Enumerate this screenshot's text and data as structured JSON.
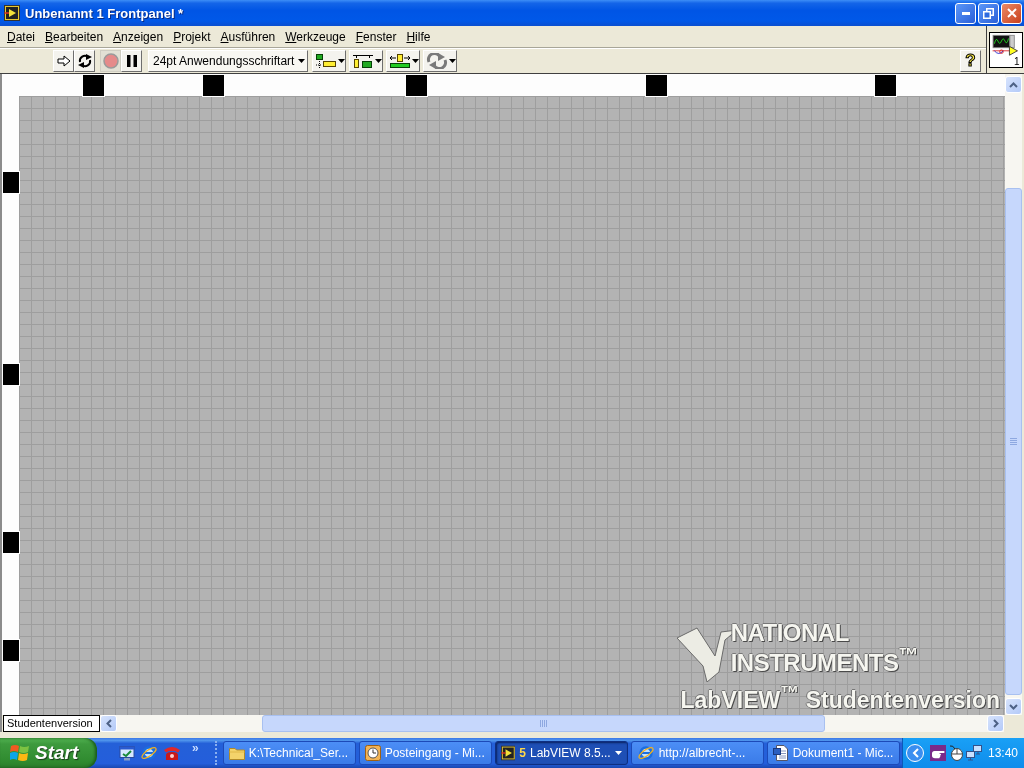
{
  "window": {
    "title": "Unbenannt 1 Frontpanel *"
  },
  "menu": [
    "Datei",
    "Bearbeiten",
    "Anzeigen",
    "Projekt",
    "Ausführen",
    "Werkzeuge",
    "Fenster",
    "Hilfe"
  ],
  "toolbar": {
    "buttons": [
      {
        "kind": "run",
        "disabled": false
      },
      {
        "kind": "repeat",
        "disabled": false
      },
      {
        "kind": "abort",
        "disabled": true
      },
      {
        "kind": "pause",
        "disabled": false
      }
    ],
    "font_menu": {
      "value": "24pt Anwendungsschriftart"
    },
    "dropdowns": [
      {
        "kind": "align"
      },
      {
        "kind": "distribute"
      },
      {
        "kind": "resize"
      },
      {
        "kind": "reorder"
      }
    ],
    "help": "?"
  },
  "vi_icon": {
    "number": "1"
  },
  "panel": {
    "watermark": {
      "line_1": "NATIONAL",
      "line_2": "INSTRUMENTS$^{™}$",
      "product": "LabVIEW$^{™}$ Studentenversion"
    },
    "status_label": "Studentenversion"
  },
  "taskbar": {
    "start": "Start",
    "quick_launch": [
      {
        "kind": "desktop"
      },
      {
        "kind": "browser"
      },
      {
        "kind": "phone"
      }
    ],
    "more": "»",
    "tasks": [
      {
        "kind": "folder",
        "label": "K:\\Technical_Ser...",
        "selected": false
      },
      {
        "kind": "mail",
        "label": "Posteingang - Mi...",
        "selected": false
      },
      {
        "kind": "labview",
        "count": "5",
        "label": "LabVIEW 8.5...",
        "selected": true
      },
      {
        "kind": "browser",
        "label": "http://albrecht-...",
        "selected": false
      },
      {
        "kind": "word",
        "label": "Dokument1 - Mic...",
        "selected": false
      }
    ],
    "tray": {
      "icons": [
        {
          "kind": "hand"
        },
        {
          "kind": "mouse"
        },
        {
          "kind": "network"
        }
      ],
      "clock": "13:40"
    }
  }
}
